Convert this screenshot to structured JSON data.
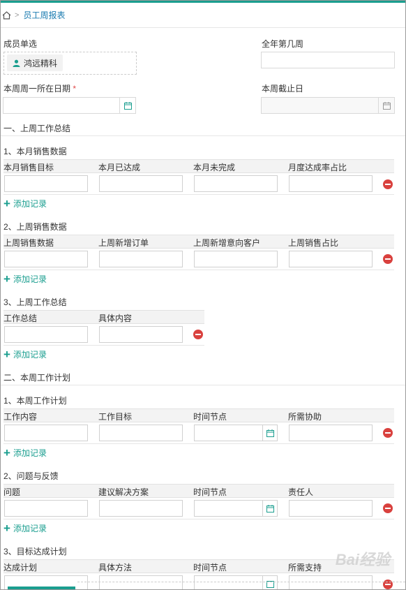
{
  "breadcrumb": {
    "current": "员工周报表"
  },
  "member": {
    "label": "成员单选",
    "chip": "鸿远精科"
  },
  "week_of_year": {
    "label": "全年第几周",
    "value": ""
  },
  "monday_date": {
    "label": "本周周一所在日期",
    "required_mark": "*"
  },
  "week_end": {
    "label": "本周截止日"
  },
  "section1": {
    "title": "一、上周工作总结",
    "sub1": {
      "title": "1、本月销售数据",
      "columns": [
        "本月销售目标",
        "本月已达成",
        "本月未完成",
        "月度达成率占比"
      ],
      "add": "添加记录"
    },
    "sub2": {
      "title": "2、上周销售数据",
      "columns": [
        "上周销售数据",
        "上周新增订单",
        "上周新增意向客户",
        "上周销售占比"
      ],
      "add": "添加记录"
    },
    "sub3": {
      "title": "3、上周工作总结",
      "columns": [
        "工作总结",
        "具体内容"
      ],
      "add": "添加记录"
    }
  },
  "section2": {
    "title": "二、本周工作计划",
    "sub1": {
      "title": "1、本周工作计划",
      "columns": [
        "工作内容",
        "工作目标",
        "时间节点",
        "所需协助"
      ],
      "add": "添加记录"
    },
    "sub2": {
      "title": "2、问题与反馈",
      "columns": [
        "问题",
        "建议解决方案",
        "时间节点",
        "责任人"
      ],
      "add": "添加记录"
    },
    "sub3": {
      "title": "3、目标达成计划",
      "columns": [
        "达成计划",
        "具体方法",
        "时间节点",
        "所需支持"
      ]
    }
  },
  "watermark": "Bai经验",
  "colors": {
    "accent": "#1a9e8f",
    "delete": "#d9413e",
    "link": "#1a7bb0"
  }
}
